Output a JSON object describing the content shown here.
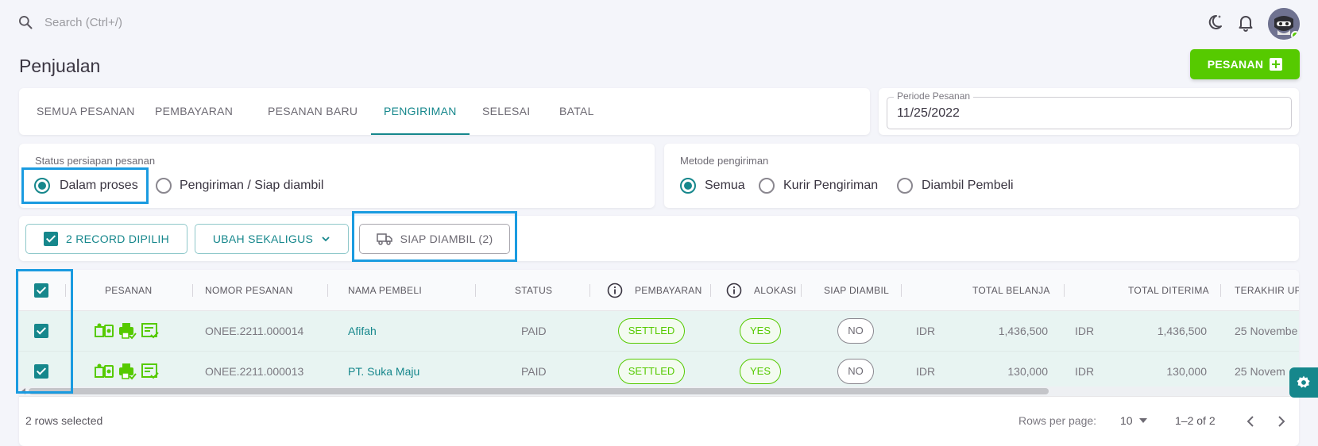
{
  "topbar": {
    "search_placeholder": "Search (Ctrl+/)",
    "icons": [
      "search-icon",
      "theme-toggle-icon",
      "bell-icon",
      "avatar"
    ]
  },
  "page": {
    "title": "Penjualan",
    "new_order_button": "PESANAN"
  },
  "tabs": [
    {
      "label": "SEMUA PESANAN",
      "active": false
    },
    {
      "label": "PEMBAYARAN",
      "active": false
    },
    {
      "label": "PESANAN BARU",
      "active": false
    },
    {
      "label": "PENGIRIMAN",
      "active": true
    },
    {
      "label": "SELESAI",
      "active": false
    },
    {
      "label": "BATAL",
      "active": false
    }
  ],
  "period": {
    "label": "Periode Pesanan",
    "value": "11/25/2022"
  },
  "status_group": {
    "label": "Status persiapan pesanan",
    "options": [
      {
        "label": "Dalam proses",
        "selected": true
      },
      {
        "label": "Pengiriman / Siap diambil",
        "selected": false
      }
    ]
  },
  "method_group": {
    "label": "Metode pengiriman",
    "options": [
      {
        "label": "Semua",
        "selected": true
      },
      {
        "label": "Kurir Pengiriman",
        "selected": false
      },
      {
        "label": "Diambil Pembeli",
        "selected": false
      }
    ]
  },
  "actions": {
    "selected_records": "2 RECORD DIPILIH",
    "bulk_change": "UBAH SEKALIGUS",
    "ready_pickup": "SIAP DIAMBIL (2)"
  },
  "table": {
    "columns": [
      "PESANAN",
      "NOMOR PESANAN",
      "NAMA PEMBELI",
      "STATUS",
      "PEMBAYARAN",
      "ALOKASI",
      "SIAP DIAMBIL",
      "TOTAL BELANJA",
      "TOTAL DITERIMA",
      "TERAKHIR UPI"
    ],
    "rows": [
      {
        "order_no": "ONEE.2211.000014",
        "buyer": "Afifah",
        "status": "PAID",
        "payment": "SETTLED",
        "allocation": "YES",
        "ready": "NO",
        "total_currency": "IDR",
        "total": "1,436,500",
        "received_currency": "IDR",
        "received": "1,436,500",
        "updated": "25 Novembe",
        "checked": true
      },
      {
        "order_no": "ONEE.2211.000013",
        "buyer": "PT. Suka Maju",
        "status": "PAID",
        "payment": "SETTLED",
        "allocation": "YES",
        "ready": "NO",
        "total_currency": "IDR",
        "total": "130,000",
        "received_currency": "IDR",
        "received": "130,000",
        "updated": "25 Novem",
        "checked": true
      }
    ],
    "footer": {
      "selected": "2 rows selected",
      "rows_per_page_label": "Rows per page:",
      "rows_per_page": "10",
      "range": "1–2 of 2"
    }
  },
  "colors": {
    "primary": "#16878c",
    "success": "#56ca00",
    "highlight": "#1a9be0"
  }
}
